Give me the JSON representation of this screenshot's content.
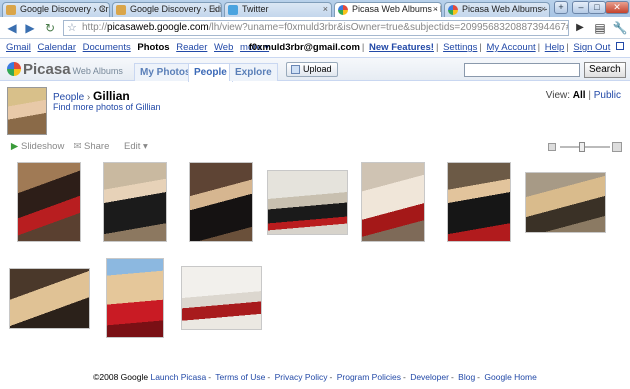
{
  "browser": {
    "tabs": [
      {
        "title": "Google Discovery › Cri…",
        "active": false,
        "favicon": "google-icon"
      },
      {
        "title": "Google Discovery › Edit…",
        "active": false,
        "favicon": "google-icon"
      },
      {
        "title": "Twitter",
        "active": false,
        "favicon": "twitter-icon"
      },
      {
        "title": "Picasa Web Albums - P…",
        "active": true,
        "favicon": "picasa-icon"
      },
      {
        "title": "Picasa Web Albums - N…",
        "active": false,
        "favicon": "picasa-icon"
      }
    ],
    "url_prefix": "http://",
    "url_host": "picasaweb.google.com",
    "url_rest": "/lh/view?uname=f0xmuld3rbr&isOwner=true&subjectids=2099568320887394467#"
  },
  "gbar": {
    "links": [
      "Gmail",
      "Calendar",
      "Documents",
      "Photos",
      "Reader",
      "Web",
      "more ▾"
    ],
    "current": "Photos",
    "email": "f0xmuld3rbr@gmail.com",
    "right_links": [
      "New Features!",
      "Settings",
      "My Account",
      "Help",
      "Sign Out"
    ]
  },
  "picasa": {
    "logo": "Picasa",
    "logo_sub": "Web Albums",
    "tabs": [
      {
        "label": "My Photos",
        "active": false
      },
      {
        "label": "People",
        "active": true
      },
      {
        "label": "Explore",
        "active": false
      }
    ],
    "upload_label": "Upload",
    "search_button": "Search",
    "search_value": ""
  },
  "person": {
    "breadcrumb_root": "People",
    "breadcrumb_sep": "›",
    "name": "Gillian",
    "find_more": "Find more photos of Gillian",
    "view_label": "View:",
    "view_all": "All",
    "view_public": "Public"
  },
  "toolbar": {
    "slideshow": "Slideshow",
    "share": "Share",
    "edit": "Edit ▾"
  },
  "photos": [
    {
      "name": "photo-1"
    },
    {
      "name": "photo-2"
    },
    {
      "name": "photo-3"
    },
    {
      "name": "photo-4"
    },
    {
      "name": "photo-5"
    },
    {
      "name": "photo-6"
    },
    {
      "name": "photo-7"
    },
    {
      "name": "photo-8"
    },
    {
      "name": "photo-9"
    },
    {
      "name": "photo-10"
    }
  ],
  "footer": {
    "copyright": "©2008 Google",
    "links": [
      "Launch Picasa",
      "Terms of Use",
      "Privacy Policy",
      "Program Policies",
      "Developer",
      "Blog",
      "Google Home"
    ]
  }
}
